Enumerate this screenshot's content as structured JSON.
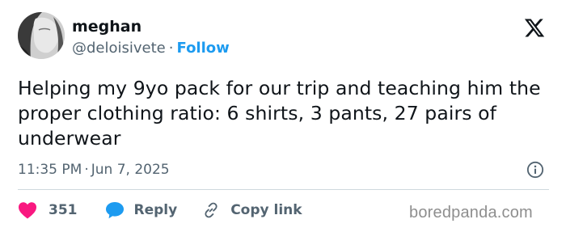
{
  "author": {
    "name": "meghan",
    "handle": "@deloisivete",
    "separator": "·",
    "follow_label": "Follow"
  },
  "tweet": {
    "text": "Helping my 9yo pack for our trip and teaching him the proper clothing ratio: 6 shirts, 3 pants, 27 pairs of underwear",
    "time": "11:35 PM",
    "separator": "·",
    "date": "Jun 7, 2025"
  },
  "actions": {
    "like_count": "351",
    "reply_label": "Reply",
    "copy_link_label": "Copy link"
  },
  "icons": {
    "platform": "x-logo-icon",
    "info": "info-icon",
    "like": "heart-icon",
    "reply": "speech-bubble-icon",
    "copy": "link-icon"
  },
  "colors": {
    "accent": "#1d9bf0",
    "like": "#f91880",
    "text": "#0f1419",
    "muted": "#536471"
  },
  "watermark": "boredpanda.com"
}
